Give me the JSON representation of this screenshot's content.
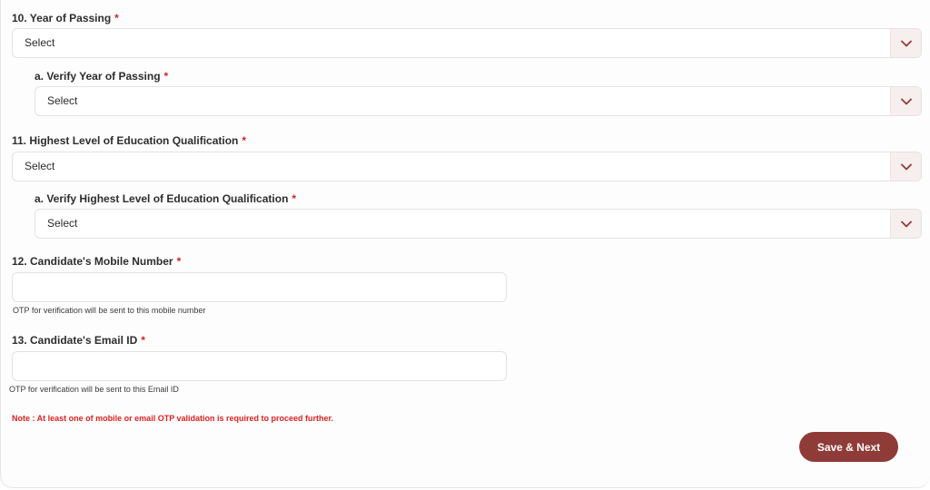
{
  "fields": [
    {
      "label": "10. Year of Passing",
      "value": "Select"
    },
    {
      "label": "a. Verify Year of Passing",
      "value": "Select"
    },
    {
      "label": "11. Highest Level of Education Qualification",
      "value": "Select"
    },
    {
      "label": "a. Verify Highest Level of Education Qualification",
      "value": "Select"
    }
  ],
  "required_marker": "*",
  "mobile": {
    "label": "12. Candidate's Mobile Number",
    "value": "",
    "hint": "OTP for verification will be sent to this mobile number"
  },
  "email": {
    "label": "13. Candidate's Email ID",
    "value": "",
    "hint": "OTP for verification will be sent to this Email ID"
  },
  "note": "Note : At least one of mobile or email OTP validation is required to proceed further.",
  "save_button": "Save & Next",
  "colors": {
    "accent": "#8f3b38",
    "required": "#d02424",
    "note": "#e01f1f"
  },
  "icons": {
    "dropdown": "chevron-down-icon"
  }
}
